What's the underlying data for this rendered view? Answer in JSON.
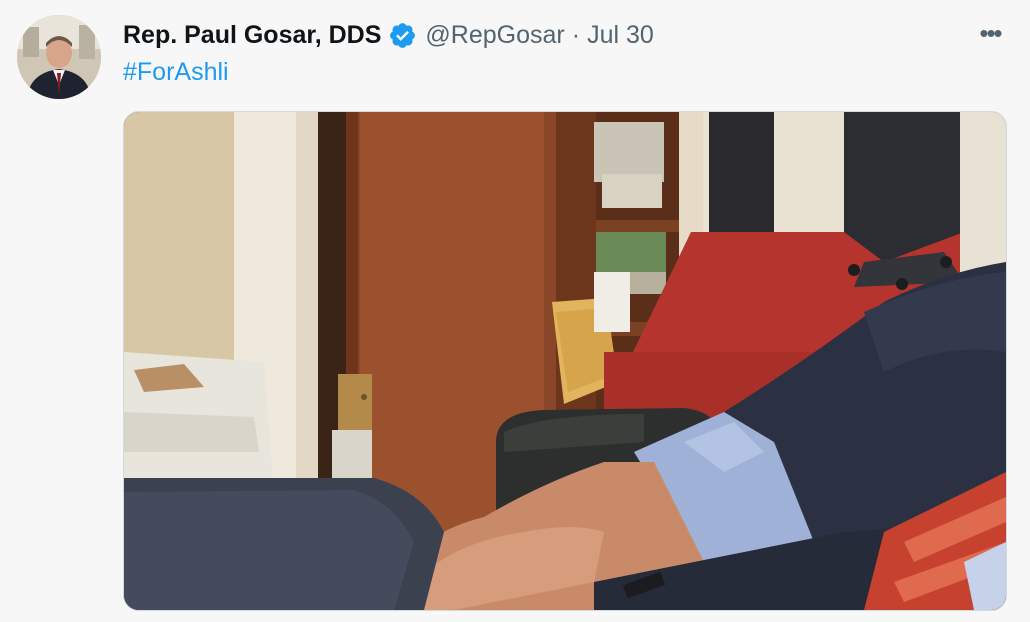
{
  "tweet": {
    "author": {
      "display_name": "Rep. Paul Gosar, DDS",
      "verified_icon": "verified-badge-icon",
      "handle": "@RepGosar",
      "separator": "·",
      "date": "Jul 30"
    },
    "more_label": "•••",
    "text": "#ForAshli",
    "media": {
      "type": "photo"
    }
  },
  "colors": {
    "background": "#f7f7f7",
    "link": "#1d9bf0",
    "secondary_text": "#536471",
    "verified": "#1d9bf0"
  }
}
